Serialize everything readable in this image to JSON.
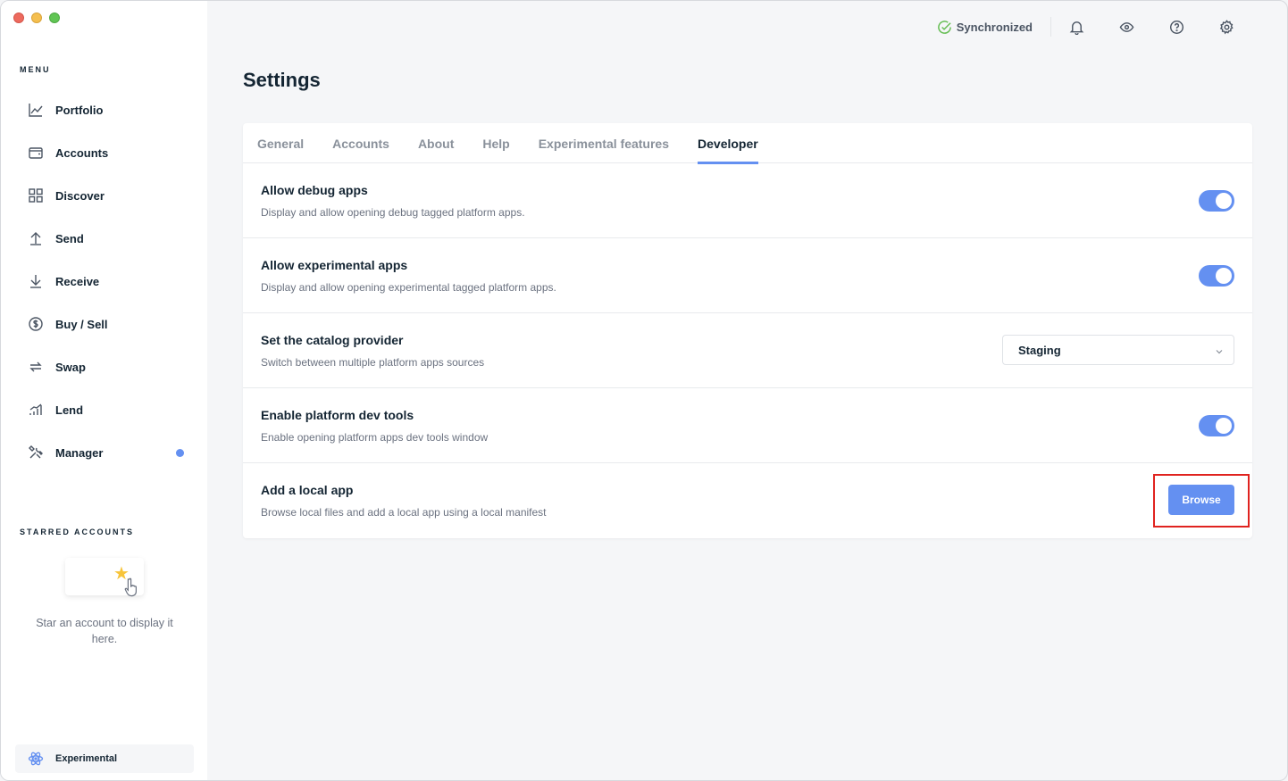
{
  "sidebar": {
    "menu_title": "MENU",
    "items": [
      {
        "label": "Portfolio",
        "icon": "chart-line-icon"
      },
      {
        "label": "Accounts",
        "icon": "wallet-icon"
      },
      {
        "label": "Discover",
        "icon": "grid-icon"
      },
      {
        "label": "Send",
        "icon": "arrow-up-icon"
      },
      {
        "label": "Receive",
        "icon": "arrow-down-icon"
      },
      {
        "label": "Buy / Sell",
        "icon": "dollar-circle-icon"
      },
      {
        "label": "Swap",
        "icon": "swap-icon"
      },
      {
        "label": "Lend",
        "icon": "bar-chart-icon"
      },
      {
        "label": "Manager",
        "icon": "tools-icon",
        "notification_dot": true
      }
    ],
    "starred_title": "STARRED ACCOUNTS",
    "starred_empty": "Star an account to display it here.",
    "experimental_label": "Experimental"
  },
  "topbar": {
    "sync_label": "Synchronized",
    "icons": [
      "bell-icon",
      "eye-icon",
      "help-icon",
      "settings-icon"
    ]
  },
  "page": {
    "title": "Settings",
    "tabs": [
      {
        "label": "General",
        "active": false
      },
      {
        "label": "Accounts",
        "active": false
      },
      {
        "label": "About",
        "active": false
      },
      {
        "label": "Help",
        "active": false
      },
      {
        "label": "Experimental features",
        "active": false
      },
      {
        "label": "Developer",
        "active": true
      }
    ],
    "rows": {
      "debug": {
        "title": "Allow debug apps",
        "desc": "Display and allow opening debug tagged platform apps.",
        "enabled": true
      },
      "experimental": {
        "title": "Allow experimental apps",
        "desc": "Display and allow opening experimental tagged platform apps.",
        "enabled": true
      },
      "catalog": {
        "title": "Set the catalog provider",
        "desc": "Switch between multiple platform apps sources",
        "selected": "Staging"
      },
      "devtools": {
        "title": "Enable platform dev tools",
        "desc": "Enable opening platform apps dev tools window",
        "enabled": true
      },
      "local_app": {
        "title": "Add a local app",
        "desc": "Browse local files and add a local app using a local manifest",
        "button": "Browse"
      }
    }
  },
  "colors": {
    "accent": "#6490f1",
    "highlight": "#e0231f",
    "sync_check": "#66be54"
  }
}
